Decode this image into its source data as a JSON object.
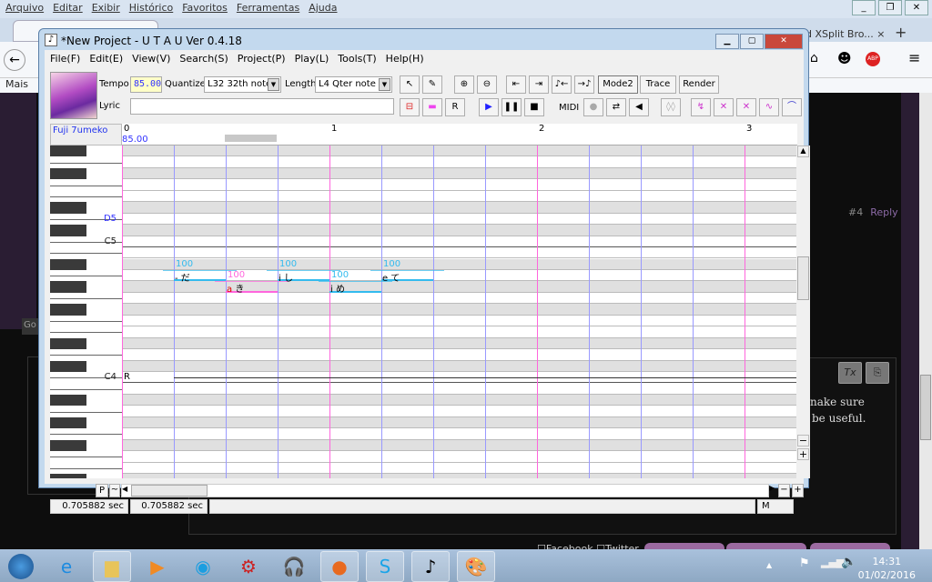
{
  "browser": {
    "menu": [
      "Arquivo",
      "Editar",
      "Exibir",
      "Histórico",
      "Favoritos",
      "Ferramentas",
      "Ajuda"
    ],
    "other_tab": "d XSplit Bro...",
    "bookmark": "Mais",
    "page": {
      "post_num": "#4",
      "reply": "Reply",
      "editor_text": [
        "nake sure",
        "be useful."
      ],
      "sidebar_btn": "Go",
      "share": [
        "Facebook",
        "Twitter"
      ]
    }
  },
  "taskbar": {
    "time": "14:31",
    "date": "01/02/2016"
  },
  "utau": {
    "title": "*New Project - U T A U Ver 0.4.18",
    "menu": [
      "File(F)",
      "Edit(E)",
      "View(V)",
      "Search(S)",
      "Project(P)",
      "Play(L)",
      "Tools(T)",
      "Help(H)"
    ],
    "tempo_label": "Tempo",
    "tempo": "85.00",
    "quantize_label": "Quantize",
    "quantize": "L32 32th note",
    "length_label": "Length",
    "length": "L4  Qter note",
    "lyric_label": "Lyric",
    "lyric": "",
    "mode2": "Mode2",
    "trace": "Trace",
    "render": "Render",
    "midi": "MIDI",
    "singer": "Fuji 7umeko",
    "ruler_tempo": "85.00",
    "bars": [
      "0",
      "1",
      "2",
      "3"
    ],
    "key_labels": [
      {
        "row": 6,
        "text": "D5",
        "highlight": true
      },
      {
        "row": 8,
        "text": "C5"
      },
      {
        "row": 20,
        "text": "C4"
      }
    ],
    "rest_marker": "R",
    "notes": [
      {
        "lyric": "だ",
        "prefix": "-",
        "beat": 1,
        "row": 11,
        "velocity": "100",
        "color": "#33bbee"
      },
      {
        "lyric": "き",
        "prefix": "a",
        "beat": 2,
        "row": 12,
        "velocity": "100",
        "color": "#ff66dd"
      },
      {
        "lyric": "し",
        "prefix": "i",
        "beat": 3,
        "row": 11,
        "velocity": "100",
        "color": "#33bbee"
      },
      {
        "lyric": "め",
        "prefix": "i",
        "beat": 4,
        "row": 12,
        "velocity": "100",
        "color": "#33bbee"
      },
      {
        "lyric": "て",
        "prefix": "e",
        "beat": 5,
        "row": 11,
        "velocity": "100",
        "color": "#33bbee"
      }
    ],
    "p_button": "P",
    "tilde_button": "~",
    "status": [
      "0.705882 sec",
      "0.705882 sec",
      "",
      "M"
    ]
  }
}
